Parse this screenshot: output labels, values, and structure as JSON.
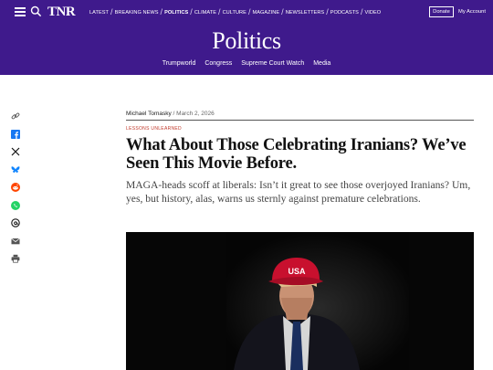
{
  "header": {
    "logo": "TNR",
    "nav": [
      {
        "label": "Latest",
        "active": false
      },
      {
        "label": "Breaking News",
        "active": false
      },
      {
        "label": "Politics",
        "active": true
      },
      {
        "label": "Climate",
        "active": false
      },
      {
        "label": "Culture",
        "active": false
      },
      {
        "label": "Magazine",
        "active": false
      },
      {
        "label": "Newsletters",
        "active": false
      },
      {
        "label": "Podcasts",
        "active": false
      },
      {
        "label": "Video",
        "active": false
      }
    ],
    "donate_label": "Donate",
    "account_label": "My Account",
    "icons": [
      "menu-icon",
      "search-icon"
    ]
  },
  "section": {
    "title": "Politics",
    "subnav": [
      "Trumpworld",
      "Congress",
      "Supreme Court Watch",
      "Media"
    ]
  },
  "share": [
    "link-icon",
    "facebook-icon",
    "x-icon",
    "bluesky-icon",
    "reddit-icon",
    "whatsapp-icon",
    "threads-icon",
    "email-icon",
    "print-icon"
  ],
  "article": {
    "author": "Michael Tomasky",
    "byline_sep": " / ",
    "date": "March 2, 2026",
    "kicker": "Lessons Unlearned",
    "headline": "What About Those Celebrating Iranians? We’ve Seen This Movie Before.",
    "dek": "MAGA-heads scoff at liberals: Isn’t it great to see those overjoyed Iranians? Um, yes, but history, alas, warns us sternly against premature celebrations.",
    "photo": {
      "cap_text": "USA"
    }
  },
  "colors": {
    "brand_purple": "#3f1a8c",
    "kicker_red": "#c0392b",
    "facebook": "#1877f2",
    "bluesky": "#1185fe",
    "reddit": "#ff4500",
    "whatsapp": "#25d366"
  }
}
